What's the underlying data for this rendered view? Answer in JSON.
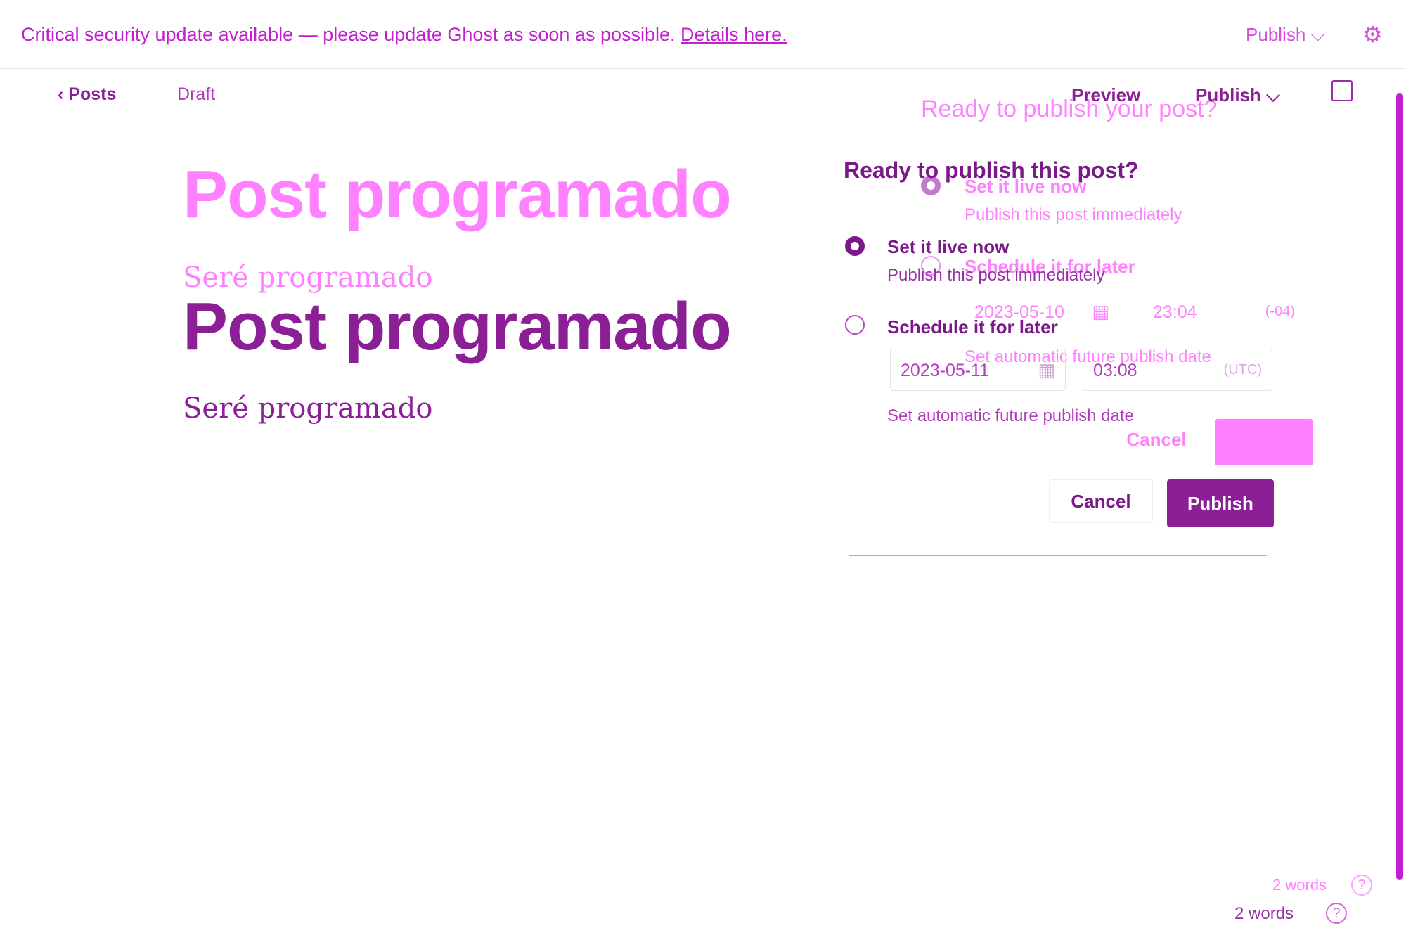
{
  "banner": {
    "prefix_overlap": "Critical security update",
    "text": "Critical security update available — please update Ghost as soon as possible.",
    "link": "Details here."
  },
  "top_bar": {
    "publish_label": "Publish",
    "settings_icon": "gear-icon"
  },
  "editor": {
    "back_label": "Posts",
    "status": "Draft",
    "title": "Post programado",
    "excerpt": "Seré programado"
  },
  "header": {
    "preview_label": "Preview",
    "publish_label": "Publish"
  },
  "publish_menu": {
    "title_ghost": "Ready to publish your post?",
    "title": "Ready to publish this post?",
    "option_now": {
      "label": "Set it live now",
      "description": "Publish this post immediately"
    },
    "option_later": {
      "label": "Schedule it for later",
      "description": "Set automatic future publish date",
      "date": "2023-05-11",
      "time": "03:08",
      "timezone": "(UTC)"
    },
    "ghost_schedule": {
      "date": "2023-05-10",
      "time": "23:04",
      "timezone": "(-04)"
    },
    "cancel_label": "Cancel",
    "publish_label": "Publish"
  },
  "footer": {
    "word_count": "2 words"
  },
  "colors": {
    "accent": "#c21fd1",
    "dark_accent": "#7a1a88",
    "ghost": "#e030e8"
  }
}
